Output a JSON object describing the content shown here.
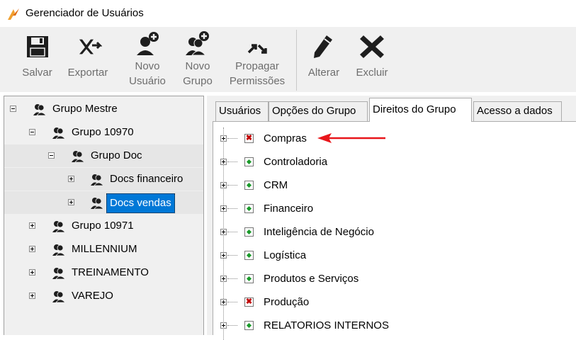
{
  "window": {
    "title": "Gerenciador de Usuários"
  },
  "toolbar": {
    "salvar": "Salvar",
    "exportar": "Exportar",
    "novo_usuario_l1": "Novo",
    "novo_usuario_l2": "Usuário",
    "novo_grupo_l1": "Novo",
    "novo_grupo_l2": "Grupo",
    "propagar_l1": "Propagar",
    "propagar_l2": "Permissões",
    "alterar": "Alterar",
    "excluir": "Excluir"
  },
  "tree": {
    "items": [
      {
        "label": "Grupo Mestre",
        "state": "expanded",
        "selected": false
      },
      {
        "label": "Grupo 10970",
        "state": "expanded",
        "selected": false
      },
      {
        "label": "Grupo Doc",
        "state": "expanded",
        "selected": false
      },
      {
        "label": "Docs financeiro",
        "state": "collapsed",
        "selected": false
      },
      {
        "label": "Docs vendas",
        "state": "collapsed",
        "selected": true
      },
      {
        "label": "Grupo 10971",
        "state": "collapsed",
        "selected": false
      },
      {
        "label": "MILLENNIUM",
        "state": "collapsed",
        "selected": false
      },
      {
        "label": "TREINAMENTO",
        "state": "collapsed",
        "selected": false
      },
      {
        "label": "VAREJO",
        "state": "collapsed",
        "selected": false
      }
    ]
  },
  "tabs": [
    {
      "label": "Usuários",
      "active": false
    },
    {
      "label": "Opções do Grupo",
      "active": false
    },
    {
      "label": "Direitos do Grupo",
      "active": true
    },
    {
      "label": "Acesso a dados",
      "active": false
    }
  ],
  "rights": [
    {
      "label": "Compras",
      "mark": "denied"
    },
    {
      "label": "Controladoria",
      "mark": "granted"
    },
    {
      "label": "CRM",
      "mark": "granted"
    },
    {
      "label": "Financeiro",
      "mark": "granted"
    },
    {
      "label": "Inteligência de Negócio",
      "mark": "granted"
    },
    {
      "label": "Logística",
      "mark": "granted"
    },
    {
      "label": "Produtos e Serviços",
      "mark": "granted"
    },
    {
      "label": "Produção",
      "mark": "denied"
    },
    {
      "label": "RELATORIOS INTERNOS",
      "mark": "granted"
    }
  ],
  "colors": {
    "selection": "#0078d7",
    "granted": "#1a9a2a",
    "denied": "#c00000",
    "annotation_arrow": "#e8161b"
  },
  "icons": {
    "app": "app-logo-icon",
    "salvar": "floppy-disk-icon",
    "exportar": "export-icon",
    "novo_usuario": "add-user-icon",
    "novo_grupo": "add-group-icon",
    "propagar": "propagate-arrows-icon",
    "alterar": "pencil-icon",
    "excluir": "delete-x-icon",
    "group": "group-people-icon"
  }
}
